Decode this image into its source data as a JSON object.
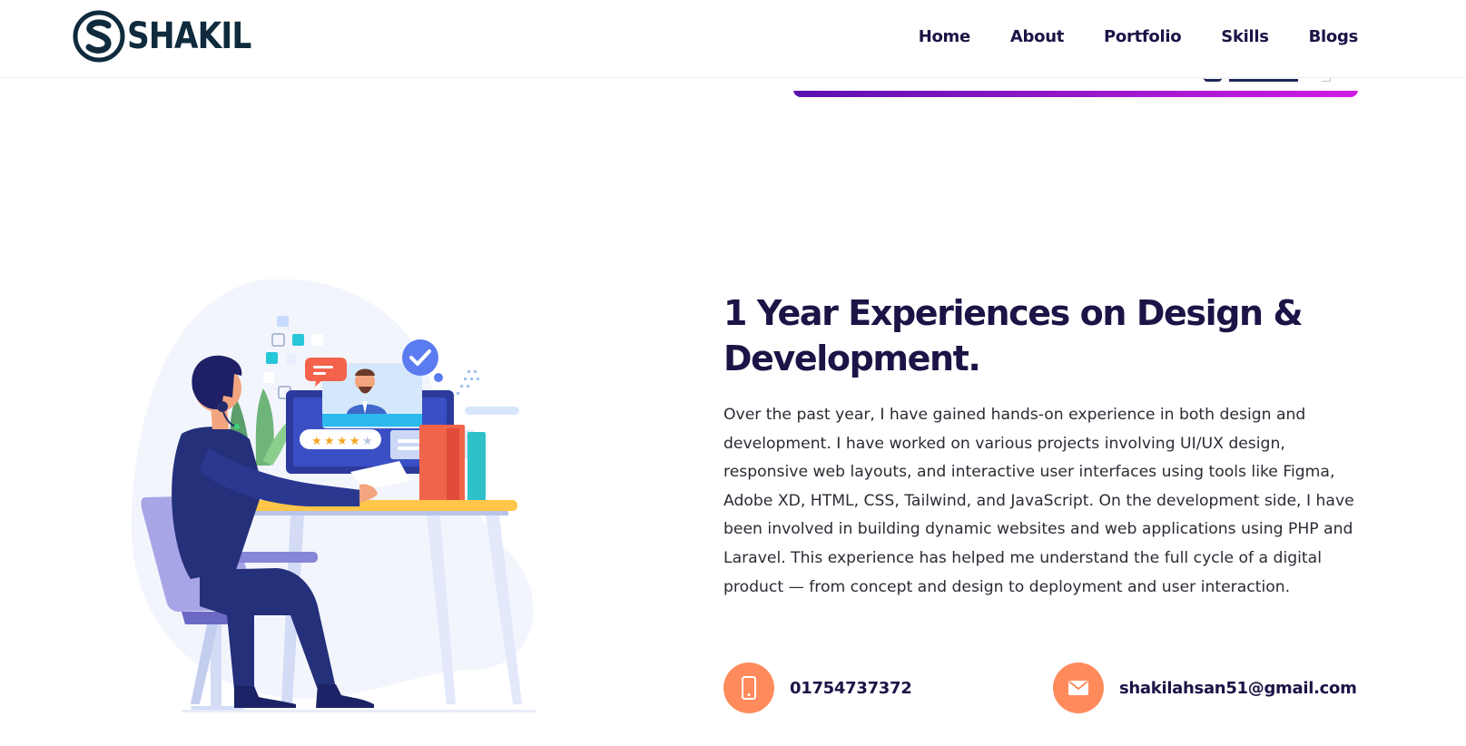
{
  "header": {
    "logo": {
      "text": "SHAKIL",
      "mark": "s-monogram-logo"
    },
    "nav": [
      {
        "label": "Home"
      },
      {
        "label": "About"
      },
      {
        "label": "Portfolio"
      },
      {
        "label": "Skills"
      },
      {
        "label": "Blogs"
      }
    ]
  },
  "portfolio_card": {
    "gradient_start": "#5b12b0",
    "gradient_end": "#d01ce4"
  },
  "experience": {
    "title": "1 Year Experiences on Design & Development.",
    "description": "Over the past year, I have gained hands-on experience in both design and development. I have worked on various projects involving UI/UX design, responsive web layouts, and interactive user interfaces using tools like Figma, Adobe XD, HTML, CSS, Tailwind, and JavaScript. On the development side, I have been involved in building dynamic websites and web applications using PHP and Laravel. This experience has helped me understand the full cycle of a digital product — from concept and design to deployment and user interaction.",
    "illustration": "developer-at-desk-illustration"
  },
  "contact": {
    "phone": {
      "icon": "phone-icon",
      "value": "01754737372"
    },
    "email": {
      "icon": "envelope-icon",
      "value": "shakilahsan51@gmail.com"
    },
    "icon_color": "#ff8b5c"
  },
  "colors": {
    "heading": "#1b1446",
    "body_text": "#2b2b35",
    "logo": "#0f2b3d",
    "accent": "#ff8b5c"
  }
}
